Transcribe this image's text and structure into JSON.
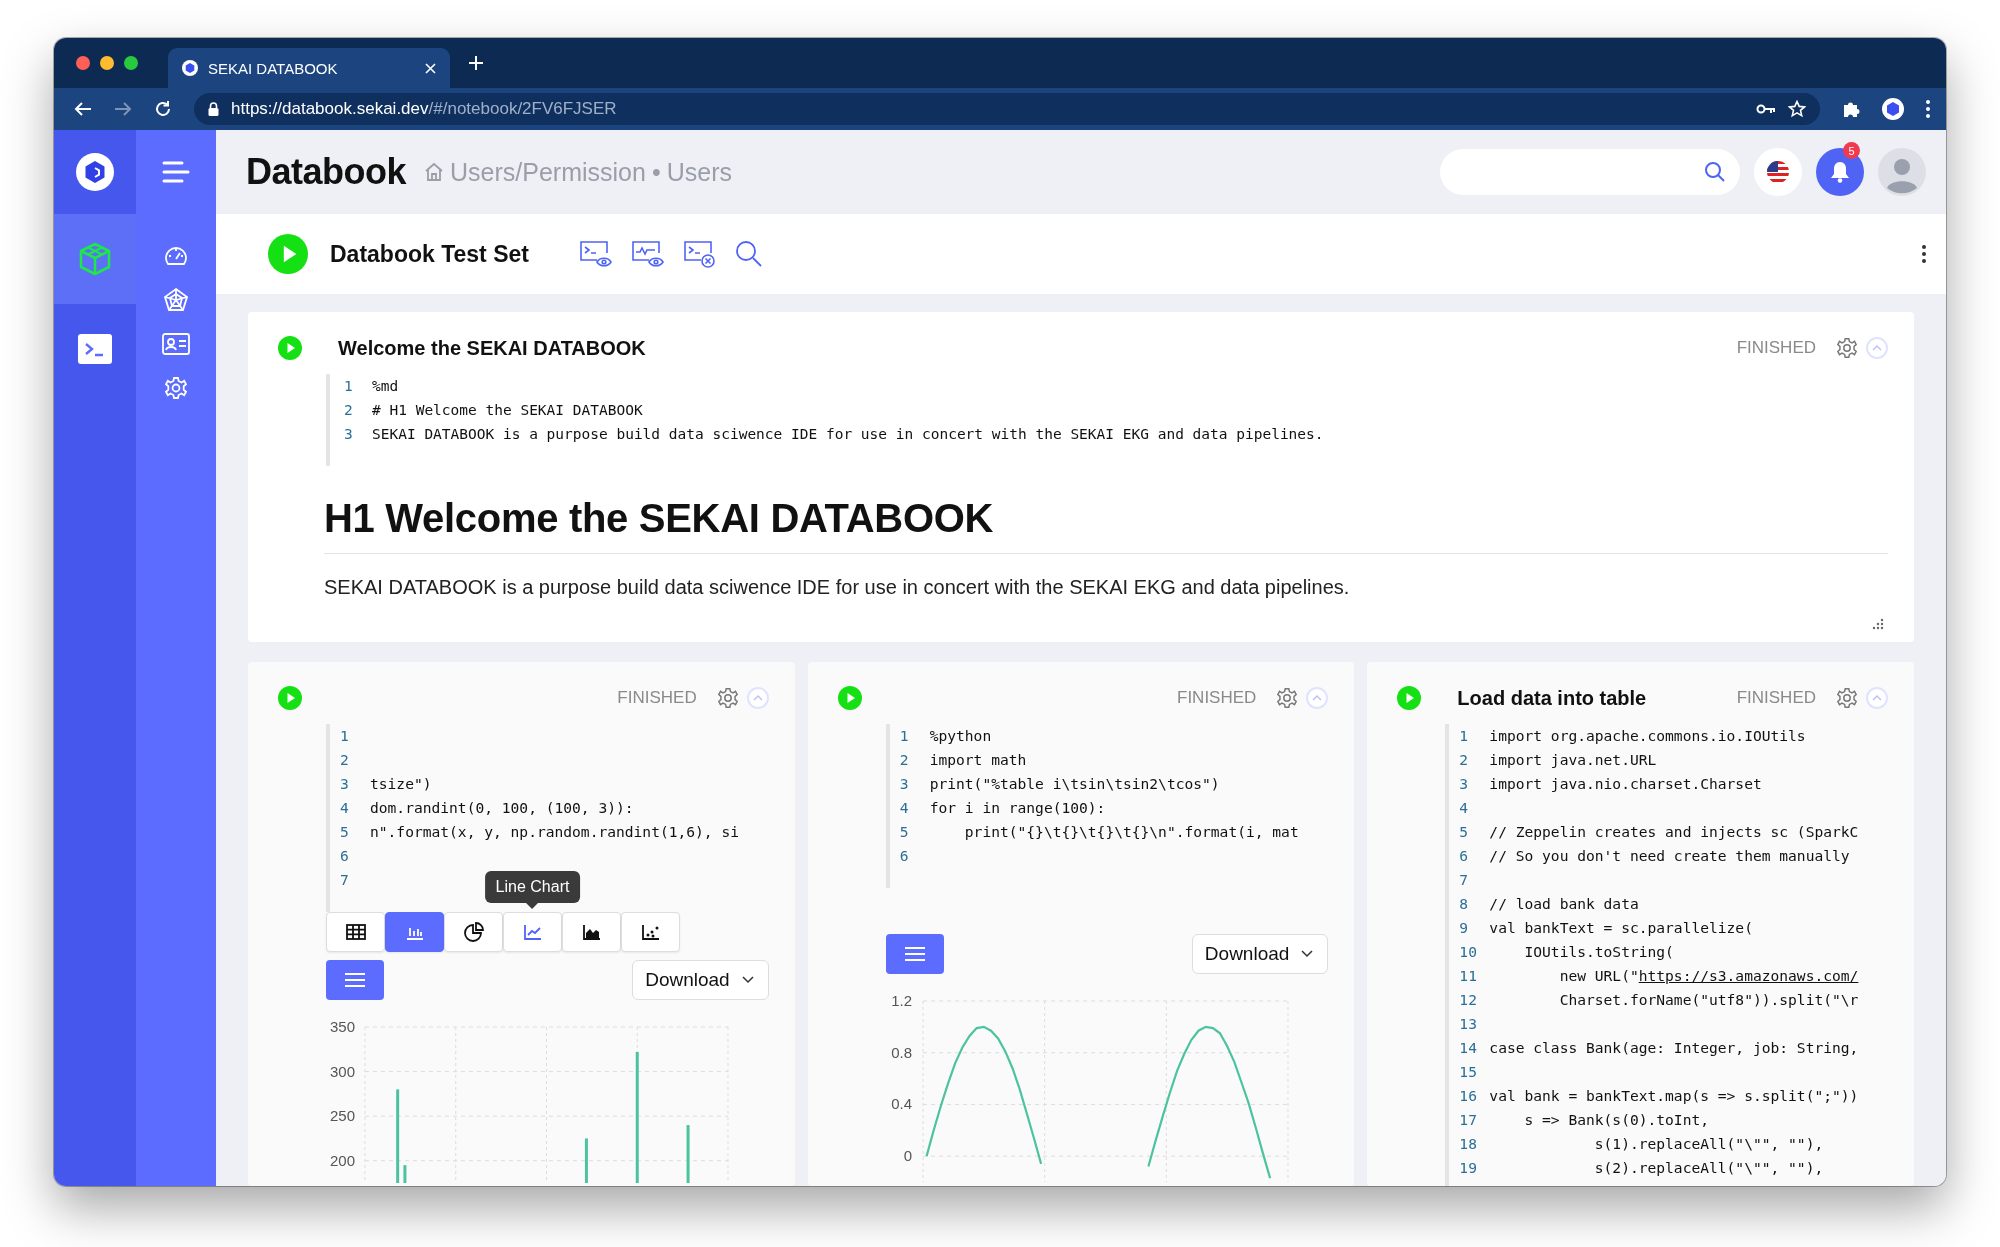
{
  "browser": {
    "tab": {
      "title": "SEKAI DATABOOK"
    },
    "address": {
      "host": "https://databook.sekai.dev",
      "path": "/#/notebook/2FV6FJSER"
    }
  },
  "nav_rail": [
    {
      "kind": "cube",
      "selected": true
    },
    {
      "kind": "terminal",
      "selected": false
    }
  ],
  "sidebar": [
    {
      "kind": "gauge"
    },
    {
      "kind": "web"
    },
    {
      "kind": "card"
    },
    {
      "kind": "gear"
    }
  ],
  "header": {
    "title": "Databook",
    "breadcrumb": "Users/Permission",
    "separator": "•",
    "current": "Users",
    "notifications": "5"
  },
  "notebook": {
    "title": "Databook Test Set"
  },
  "paragraphs": [
    {
      "title": "Welcome the SEKAI DATABOOK",
      "status": "FINISHED",
      "code": [
        {
          "n": "1",
          "code": "%md"
        },
        {
          "n": "2",
          "code": "# H1 Welcome the SEKAI DATABOOK"
        },
        {
          "n": "3",
          "code": "SEKAI DATABOOK is a purpose build data sciwence IDE for use in concert with the SEKAI EKG and data pipelines."
        }
      ],
      "output": {
        "kind": "markdown",
        "heading": "H1 Welcome the SEKAI DATABOOK",
        "text": "SEKAI DATABOOK is a purpose build data sciwence IDE for use in concert with the SEKAI EKG and data pipelines."
      }
    },
    {
      "status": "FINISHED",
      "code": [
        {
          "n": "1"
        },
        {
          "n": "2"
        },
        {
          "n": "3",
          "code": "tsize\")"
        },
        {
          "n": "4",
          "code": "dom.randint(0, 100, (100, 3)):"
        },
        {
          "n": "5",
          "code": "n\".format(x, y, np.random.randint(1,6), si"
        },
        {
          "n": "6"
        },
        {
          "n": "7"
        }
      ],
      "output": {
        "kind": "chart",
        "chart_types": [
          {
            "kind": "table",
            "selected": false
          },
          {
            "kind": "bar",
            "selected": true
          },
          {
            "kind": "pie",
            "selected": false
          },
          {
            "kind": "line",
            "selected": false,
            "tooltip": "Line Chart"
          },
          {
            "kind": "area",
            "selected": false
          },
          {
            "kind": "scatter",
            "selected": false
          }
        ],
        "download": "Download",
        "chart_data": {
          "type": "bar",
          "grid": true,
          "ylim": [
            175,
            350
          ],
          "yticks": [
            200,
            250,
            300,
            350
          ],
          "series": [
            {
              "color": "#4cc3a0",
              "values": [
                null,
                null,
                null,
                null,
                280,
                195,
                null,
                null,
                null,
                null,
                null,
                null,
                null,
                null,
                null,
                null,
                null,
                null,
                null,
                null,
                null,
                null,
                null,
                null,
                null,
                null,
                null,
                null,
                null,
                null,
                225,
                null,
                null,
                null,
                null,
                null,
                null,
                322,
                null,
                null,
                null,
                null,
                null,
                null,
                240,
                null,
                null,
                null,
                null,
                null
              ]
            }
          ]
        }
      }
    },
    {
      "status": "FINISHED",
      "code": [
        {
          "n": "1",
          "code": "%python"
        },
        {
          "n": "2",
          "code": "import math"
        },
        {
          "n": "3",
          "code": "print(\"%table i\\tsin\\tsin2\\tcos\")"
        },
        {
          "n": "4",
          "code": "for i in range(100):"
        },
        {
          "n": "5",
          "code": "    print(\"{}\\t{}\\t{}\\t{}\\n\".format(i, mat"
        },
        {
          "n": "6"
        }
      ],
      "output": {
        "kind": "chart",
        "download": "Download",
        "chart_data": {
          "type": "line",
          "grid": true,
          "categories": [
            null,
            null,
            null,
            null,
            null,
            null,
            null,
            null,
            null,
            null,
            null,
            null,
            null,
            null,
            null,
            null,
            null,
            null,
            null,
            null,
            null,
            null,
            null,
            null,
            null,
            null,
            null,
            null,
            null,
            null,
            null,
            null,
            null,
            null,
            null,
            null,
            null,
            null,
            null,
            null,
            null,
            null,
            null,
            null,
            null,
            null,
            null,
            null,
            null,
            null,
            null
          ],
          "ylim": [
            -0.2,
            1.2
          ],
          "yticks": [
            0,
            0.4,
            0.8,
            1.2
          ],
          "series": [
            {
              "color": "#4cc3a0",
              "values": [
                0,
                0.2,
                0.39,
                0.56,
                0.72,
                0.84,
                0.93,
                0.99,
                1.0,
                0.97,
                0.91,
                0.81,
                0.68,
                0.52,
                0.33,
                0.14,
                -0.06,
                null,
                null,
                null,
                null,
                null,
                null,
                null,
                null,
                null,
                null,
                null,
                null,
                null,
                null,
                null,
                null,
                null,
                null,
                null,
                null,
                null,
                null,
                null,
                null,
                null,
                null,
                null,
                null,
                null,
                null,
                null,
                null,
                null,
                null
              ]
            },
            {
              "color": "#4cc3a0",
              "values": [
                null,
                null,
                null,
                null,
                null,
                null,
                null,
                null,
                null,
                null,
                null,
                null,
                null,
                null,
                null,
                null,
                null,
                null,
                null,
                null,
                null,
                null,
                null,
                null,
                null,
                null,
                null,
                null,
                null,
                null,
                null,
                -0.08,
                0.12,
                0.31,
                0.49,
                0.66,
                0.79,
                0.9,
                0.97,
                1.0,
                0.99,
                0.95,
                0.85,
                0.73,
                0.57,
                0.41,
                0.22,
                0.02,
                -0.17,
                null,
                null
              ]
            }
          ]
        }
      }
    },
    {
      "title": "Load data into table",
      "status": "FINISHED",
      "code": [
        {
          "n": "1",
          "code": "import org.apache.commons.io.IOUtils"
        },
        {
          "n": "2",
          "code": "import java.net.URL"
        },
        {
          "n": "3",
          "code": "import java.nio.charset.Charset"
        },
        {
          "n": "4"
        },
        {
          "n": "5",
          "code": "// Zeppelin creates and injects sc (SparkC"
        },
        {
          "n": "6",
          "code": "// So you don't need create them manually"
        },
        {
          "n": "7"
        },
        {
          "n": "8",
          "code": "// load bank data"
        },
        {
          "n": "9",
          "code": "val bankText = sc.parallelize("
        },
        {
          "n": "10",
          "code": "    IOUtils.toString("
        },
        {
          "n": "11",
          "code": "        new URL(\"",
          "link": "https://s3.amazonaws.com/"
        },
        {
          "n": "12",
          "code": "        Charset.forName(\"utf8\")).split(\"\\r"
        },
        {
          "n": "13"
        },
        {
          "n": "14",
          "code": "case class Bank(age: Integer, job: String,"
        },
        {
          "n": "15"
        },
        {
          "n": "16",
          "code": "val bank = bankText.map(s => s.split(\";\"))"
        },
        {
          "n": "17",
          "code": "    s => Bank(s(0).toInt,"
        },
        {
          "n": "18",
          "code": "            s(1).replaceAll(\"\\\"\", \"\"),"
        },
        {
          "n": "19",
          "code": "            s(2).replaceAll(\"\\\"\", \"\"),"
        }
      ]
    }
  ]
}
